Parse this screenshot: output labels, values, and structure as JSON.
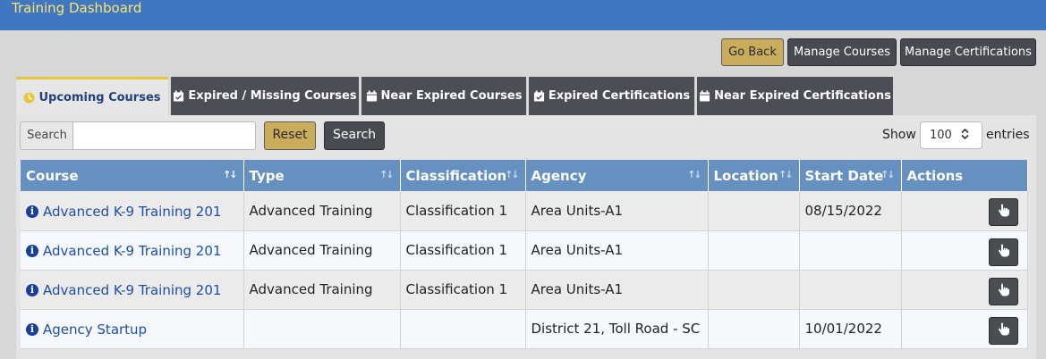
{
  "header": {
    "title": "Training Dashboard"
  },
  "toolbar": {
    "go_back": "Go Back",
    "manage_courses": "Manage Courses",
    "manage_certifications": "Manage Certifications"
  },
  "tabs": [
    {
      "label": "Upcoming Courses",
      "icon": "clock-icon",
      "active": true
    },
    {
      "label": "Expired / Missing Courses",
      "icon": "calendar-check-icon",
      "active": false
    },
    {
      "label": "Near Expired Courses",
      "icon": "calendar-icon",
      "active": false
    },
    {
      "label": "Expired Certifications",
      "icon": "calendar-check-icon",
      "active": false
    },
    {
      "label": "Near Expired Certifications",
      "icon": "calendar-icon",
      "active": false
    }
  ],
  "filters": {
    "search_label": "Search",
    "search_value": "",
    "reset": "Reset",
    "search_button": "Search",
    "show": "Show",
    "entries_value": "100",
    "entries": "entries"
  },
  "table": {
    "columns": [
      "Course",
      "Type",
      "Classification",
      "Agency",
      "Location",
      "Start Date",
      "Actions"
    ],
    "rows": [
      {
        "course": "Advanced K-9 Training 201",
        "type": "Advanced Training",
        "classification": "Classification 1",
        "agency": "Area Units-A1",
        "location": "",
        "start_date": "08/15/2022"
      },
      {
        "course": "Advanced K-9 Training 201",
        "type": "Advanced Training",
        "classification": "Classification 1",
        "agency": "Area Units-A1",
        "location": "",
        "start_date": ""
      },
      {
        "course": "Advanced K-9 Training 201",
        "type": "Advanced Training",
        "classification": "Classification 1",
        "agency": "Area Units-A1",
        "location": "",
        "start_date": ""
      },
      {
        "course": "Agency Startup",
        "type": "",
        "classification": "",
        "agency": "District 21, Toll Road - SC",
        "location": "",
        "start_date": "10/01/2022"
      }
    ]
  },
  "colors": {
    "header_bg": "#3f77c1",
    "header_text": "#ffe46b",
    "gold_button": "#c9ad5d",
    "dark_button": "#474a50",
    "table_header": "#6690bf",
    "link": "#1f4ea8"
  }
}
